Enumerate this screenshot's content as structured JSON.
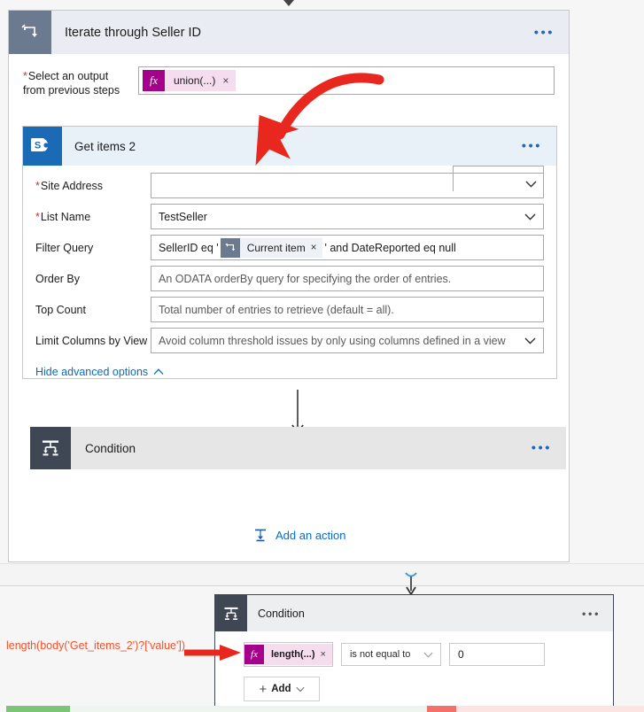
{
  "scope": {
    "title": "Iterate through Seller ID",
    "icon": "loop-icon",
    "menu": "•••",
    "select_output": {
      "label_line1": "Select an output",
      "label_line2": "from previous steps",
      "required_mark": "*",
      "token": {
        "fx": "fx",
        "text": "union(...)",
        "remove": "×"
      }
    }
  },
  "sharepoint_card": {
    "title": "Get items 2",
    "icon": "sharepoint-icon",
    "menu": "•••",
    "fields": [
      {
        "label": "Site Address",
        "required": true,
        "value": "",
        "placeholder": "",
        "control": "dropdown"
      },
      {
        "label": "List Name",
        "required": true,
        "value": "TestSeller",
        "control": "dropdown"
      },
      {
        "label": "Filter Query",
        "required": false,
        "control": "token-text",
        "prefix": "SellerID eq '",
        "token": {
          "icon": "loop-icon",
          "text": "Current item",
          "remove": "×"
        },
        "suffix": "' and DateReported eq null"
      },
      {
        "label": "Order By",
        "required": false,
        "value": "",
        "placeholder": "An ODATA orderBy query for specifying the order of entries.",
        "control": "text"
      },
      {
        "label": "Top Count",
        "required": false,
        "value": "",
        "placeholder": "Total number of entries to retrieve (default = all).",
        "control": "text"
      },
      {
        "label": "Limit Columns by View",
        "required": false,
        "value": "",
        "placeholder": "Avoid column threshold issues by only using columns defined in a view",
        "control": "dropdown"
      }
    ],
    "advanced_toggle": {
      "label": "Hide advanced options",
      "icon": "chevron-up-icon"
    }
  },
  "condition_collapsed": {
    "title": "Condition",
    "icon": "condition-icon",
    "menu": "•••"
  },
  "add_action": {
    "label": "Add an action",
    "icon": "condition-icon"
  },
  "condition_expanded": {
    "title": "Condition",
    "icon": "condition-icon",
    "menu": "•••",
    "row": {
      "left_token": {
        "fx": "fx",
        "text": "length(...)",
        "remove": "×"
      },
      "operator": "is not equal to",
      "value": "0"
    },
    "add_button": {
      "plus": "+",
      "label": "Add",
      "chevron": "chevron-down-icon"
    }
  },
  "annotations": {
    "expression_text": "length(body('Get_items_2')?['value'])",
    "color": "#f4512c"
  },
  "colors": {
    "scope_header": "#e9ecf2",
    "scope_icon": "#6b7a8f",
    "sharepoint_blue": "#1a6ab5",
    "sharepoint_header": "#e9f1f8",
    "condition_icon": "#3f4654",
    "link_blue": "#0b6cbf",
    "fx_magenta": "#a4008c",
    "token_pink": "#f6dcef",
    "annotation_red": "#f4512c",
    "status_green": "#7cc576",
    "status_red": "#f4706a"
  },
  "status_bars": {
    "green_present": true,
    "red_present": true
  }
}
